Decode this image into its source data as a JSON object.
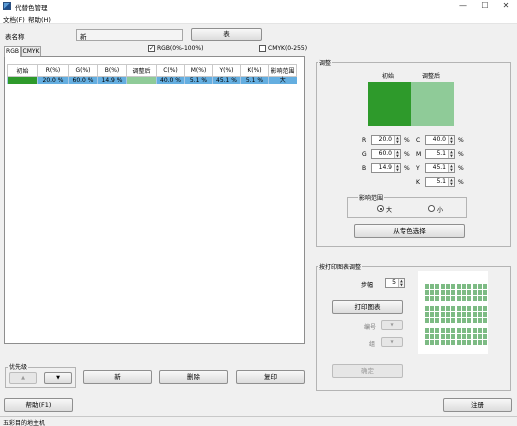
{
  "window": {
    "title": "代替色管理",
    "minimize": "—",
    "maximize": "☐",
    "close": "✕"
  },
  "menu": {
    "file": "文档(F)",
    "help": "帮助(H)"
  },
  "table_name": {
    "label": "表名称",
    "value": "新",
    "button": "表"
  },
  "tabs": [
    {
      "label": "RGB"
    },
    {
      "label": "CMYK"
    }
  ],
  "checkboxes": {
    "rgb": "RGB(0%-100%)",
    "cmyk": "CMYK(0-255)"
  },
  "grid": {
    "headers": [
      "初始",
      "R(%)",
      "G(%)",
      "B(%)",
      "调整后",
      "C(%)",
      "M(%)",
      "Y(%)",
      "K(%)",
      "影响范围"
    ],
    "rows": [
      {
        "initial_color": "#2e9a2b",
        "r": "20.0 %",
        "g": "60.0 %",
        "b": "14.9 %",
        "adjusted_color": "#8fcb98",
        "c": "40.0 %",
        "m": "5.1 %",
        "y": "45.1 %",
        "k": "5.1 %",
        "range": "大"
      }
    ]
  },
  "priority": {
    "label": "优先级",
    "up": "▲",
    "down": "▼"
  },
  "bottom_buttons": {
    "new": "新",
    "delete": "删除",
    "print": "复印"
  },
  "adjust": {
    "title": "调整",
    "initial_label": "初始",
    "adjusted_label": "调整后",
    "initial_color": "#2e9a2b",
    "adjusted_color": "#8fcb98",
    "R": {
      "label": "R",
      "value": "20.0",
      "unit": "%"
    },
    "G": {
      "label": "G",
      "value": "60.0",
      "unit": "%"
    },
    "B": {
      "label": "B",
      "value": "14.9",
      "unit": "%"
    },
    "C": {
      "label": "C",
      "value": "40.0",
      "unit": "%"
    },
    "M": {
      "label": "M",
      "value": "5.1",
      "unit": "%"
    },
    "Y": {
      "label": "Y",
      "value": "45.1",
      "unit": "%"
    },
    "K": {
      "label": "K",
      "value": "5.1",
      "unit": "%"
    },
    "range": {
      "title": "影响范围",
      "large": "大",
      "small": "小",
      "selected": "大"
    },
    "spot_button": "从专色选择"
  },
  "print_chart": {
    "title": "按打印图表调整",
    "step_label": "步幅",
    "step_value": "5",
    "print_button": "打印图表",
    "id_label": "编号",
    "group_label": "组",
    "confirm_button": "确定",
    "patch_color": "#7dbb84"
  },
  "footer": {
    "help": "帮助(F1)",
    "register": "注册"
  },
  "status": {
    "text": "五彩目的地主机"
  }
}
